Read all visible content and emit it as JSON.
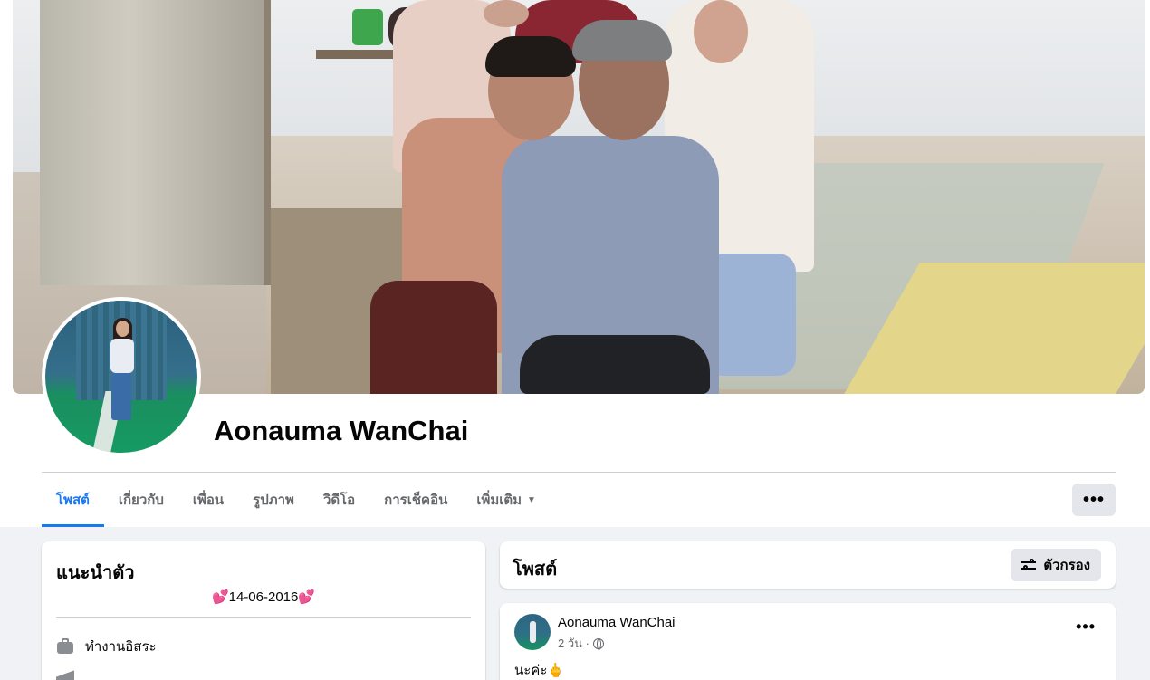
{
  "profile": {
    "name": "Aonauma WanChai"
  },
  "tabs": [
    {
      "label": "โพสต์",
      "active": true
    },
    {
      "label": "เกี่ยวกับ",
      "active": false
    },
    {
      "label": "เพื่อน",
      "active": false
    },
    {
      "label": "รูปภาพ",
      "active": false
    },
    {
      "label": "วิดีโอ",
      "active": false
    },
    {
      "label": "การเช็คอิน",
      "active": false
    },
    {
      "label": "เพิ่มเติม",
      "active": false
    }
  ],
  "more_button": "•••",
  "intro": {
    "title": "แนะนำตัว",
    "bio": "💕14-06-2016💕",
    "work": "ทำงานอิสระ",
    "icons": {
      "work": "briefcase-icon",
      "education": "graduation-cap-icon"
    }
  },
  "posts_header": {
    "title": "โพสต์",
    "filter_label": "ตัวกรอง"
  },
  "post": {
    "author": "Aonauma WanChai",
    "time": "2 วัน ·",
    "text": "นะค่ะ🖕",
    "more": "•••"
  },
  "colors": {
    "accent": "#1877f2",
    "page_bg": "#f0f2f5",
    "button_bg": "#e4e6eb",
    "secondary_text": "#65676b"
  }
}
